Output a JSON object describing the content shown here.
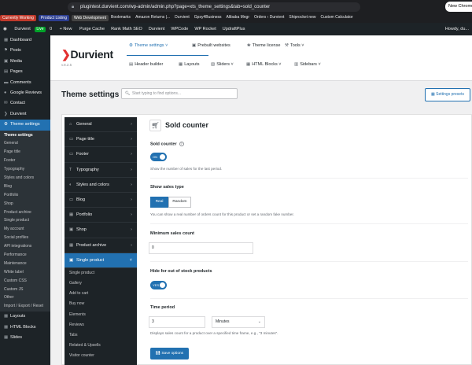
{
  "browser": {
    "url": "plugintest.durvient.com/wp-admin/admin.php?page=xts_theme_settings&tab=sold_counter",
    "new_chrome": "New Chrome",
    "bookmarks": [
      "Bookmarks",
      "Amazon Returns |...",
      "Durvient",
      "Gpsy4Business",
      "Alibaba Mngr",
      "Orders ‹ Durvient",
      "Shiprocket new",
      "Custom Calculator"
    ],
    "tags": [
      {
        "label": "Currently Working",
        "color": "#c0392b"
      },
      {
        "label": "Product Listing",
        "color": "#2c3e90"
      },
      {
        "label": "Web Development",
        "color": "#444444"
      }
    ]
  },
  "adminbar": {
    "site": "Durvient",
    "live": "Live",
    "comments": "0",
    "new": "New",
    "items": [
      "Purge Cache",
      "Rank Math SEO",
      "Durvient",
      "WPCode",
      "WP Rocket",
      "UpdraftPlus"
    ],
    "howdy": "Howdy, du..."
  },
  "sidebar": {
    "items_top": [
      {
        "label": "Dashboard",
        "icon": "dashboard-icon",
        "glyph": "▦"
      },
      {
        "label": "Posts",
        "icon": "pin-icon",
        "glyph": "⚑"
      },
      {
        "label": "Media",
        "icon": "media-icon",
        "glyph": "▣"
      },
      {
        "label": "Pages",
        "icon": "page-icon",
        "glyph": "▤"
      },
      {
        "label": "Comments",
        "icon": "comment-icon",
        "glyph": "▬"
      },
      {
        "label": "Google Reviews",
        "icon": "review-icon",
        "glyph": "●"
      },
      {
        "label": "Contact",
        "icon": "mail-icon",
        "glyph": "✉"
      },
      {
        "label": "Durvient",
        "icon": "durvient-icon",
        "glyph": "❯"
      },
      {
        "label": "Theme settings",
        "icon": "settings-icon",
        "glyph": "⚙"
      }
    ],
    "submenu": [
      "Theme settings",
      "General",
      "Page title",
      "Footer",
      "Typography",
      "Styles and colors",
      "Blog",
      "Portfolio",
      "Shop",
      "Product archive",
      "Single product",
      "My account",
      "Social profiles",
      "API integrations",
      "Performance",
      "Maintenance",
      "White label",
      "Custom CSS",
      "Custom JS",
      "Other",
      "Import / Export / Reset"
    ],
    "items_bottom": [
      {
        "label": "Layouts",
        "icon": "layout-icon",
        "glyph": "▦"
      },
      {
        "label": "HTML Blocks",
        "icon": "blocks-icon",
        "glyph": "▦"
      },
      {
        "label": "Slides",
        "icon": "slides-icon",
        "glyph": "▦"
      }
    ]
  },
  "header": {
    "logo": "Durvient",
    "version": "v.8.2.5",
    "nav_row1": [
      "Theme settings",
      "Prebuilt websites",
      "Theme license",
      "Tools"
    ],
    "nav_row2": [
      "Header builder",
      "Layouts",
      "Sliders",
      "HTML Blocks",
      "Sidebars"
    ]
  },
  "page": {
    "title": "Theme settings",
    "search_placeholder": "Start typing to find options...",
    "presets": "Settings presets"
  },
  "leftnav": {
    "items": [
      {
        "label": "General",
        "glyph": "⌂"
      },
      {
        "label": "Page title",
        "glyph": "▭"
      },
      {
        "label": "Footer",
        "glyph": "▭"
      },
      {
        "label": "Typography",
        "glyph": "T"
      },
      {
        "label": "Styles and colors",
        "glyph": "◐"
      },
      {
        "label": "Blog",
        "glyph": "▭"
      },
      {
        "label": "Portfolio",
        "glyph": "▦"
      },
      {
        "label": "Shop",
        "glyph": "▣"
      },
      {
        "label": "Product archive",
        "glyph": "▦"
      },
      {
        "label": "Single product",
        "glyph": "▣"
      }
    ],
    "sub": [
      "Single product",
      "Gallery",
      "Add to cart",
      "Buy now",
      "Elements",
      "Reviews",
      "Tabs",
      "Related & Upsells",
      "Visitor counter"
    ]
  },
  "content": {
    "title": "Sold counter",
    "sold_counter_label": "Sold counter",
    "sold_counter_toggle": "ON",
    "sold_counter_desc": "Show the number of sales for the last period.",
    "sales_type_label": "Show sales type",
    "sales_type_options": [
      "Real",
      "Random"
    ],
    "sales_type_selected": "Real",
    "sales_type_desc": "You can show a real number of orders count for this product or set a random fake number.",
    "min_sales_label": "Minimum sales count",
    "min_sales_value": "0",
    "hide_oos_label": "Hide for out of stock products",
    "hide_oos_toggle": "YES",
    "time_period_label": "Time period",
    "time_period_value": "3",
    "time_period_unit": "Minutes",
    "time_period_desc": "Displays sales count for a product over a specified time frame, e.g., \"3 minutes\".",
    "save": "Save options"
  }
}
